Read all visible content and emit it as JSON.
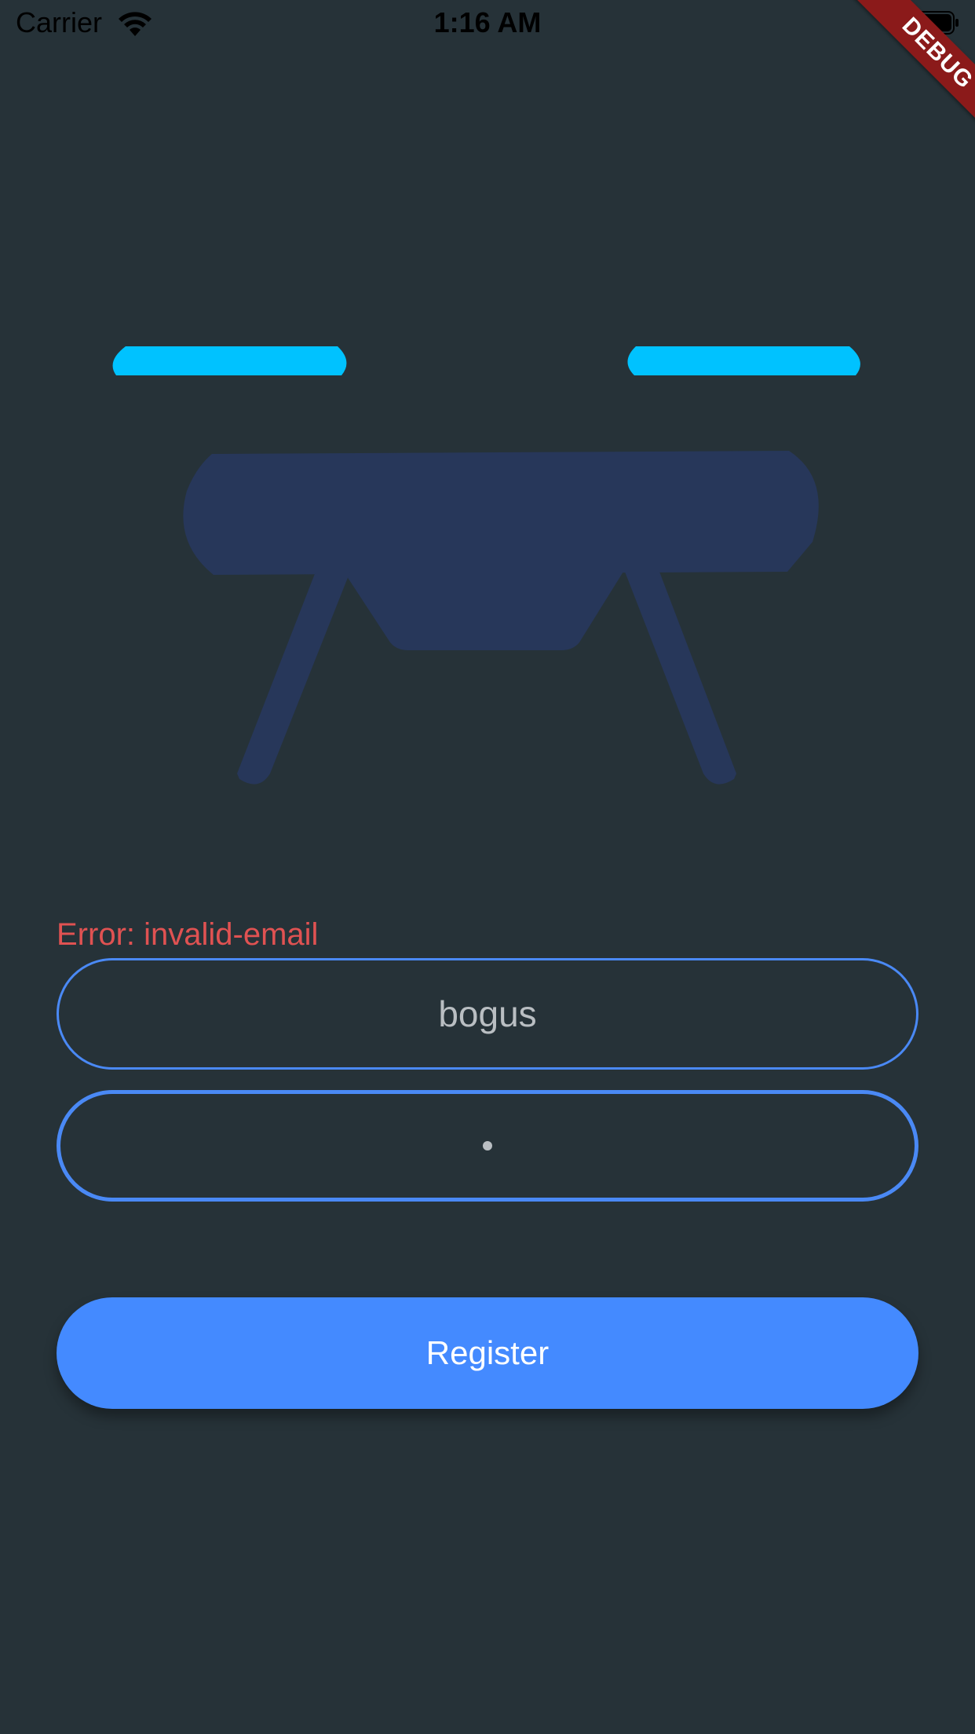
{
  "status_bar": {
    "carrier": "Carrier",
    "time": "1:16 AM",
    "wifi_icon": "wifi-icon",
    "battery_icon": "battery-icon"
  },
  "debug_banner": {
    "label": "DEBUG",
    "color": "#8b1a1a"
  },
  "illustration": {
    "icon": "drone-icon",
    "body_color": "#27375a",
    "rotor_color": "#00c2ff"
  },
  "form": {
    "error": "Error: invalid-email",
    "email_value": "bogus",
    "password_value": "•",
    "register_label": "Register"
  },
  "colors": {
    "background": "#263238",
    "accent": "#448aff",
    "field_border": "#4a89f5",
    "error": "#e05252",
    "field_text": "#b9bec2"
  }
}
